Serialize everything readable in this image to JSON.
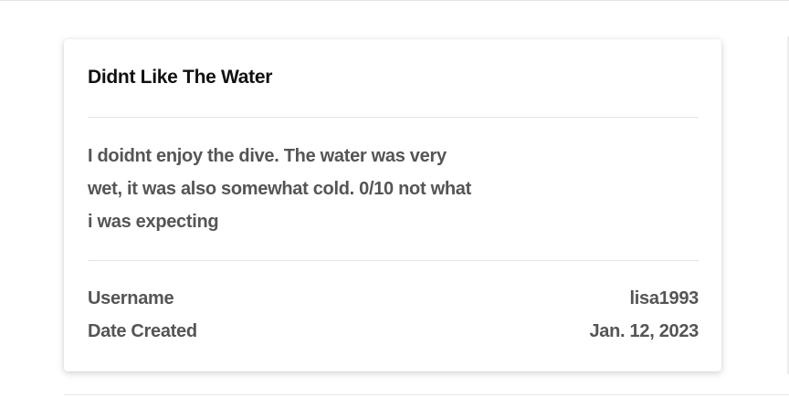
{
  "review": {
    "title": "Didnt Like The Water",
    "body": "I doidnt enjoy the dive. The water was very wet, it was also somewhat cold. 0/10 not what i was expecting",
    "meta": {
      "username_label": "Username",
      "username_value": "lisa1993",
      "date_label": "Date Created",
      "date_value": "Jan. 12, 2023"
    }
  }
}
